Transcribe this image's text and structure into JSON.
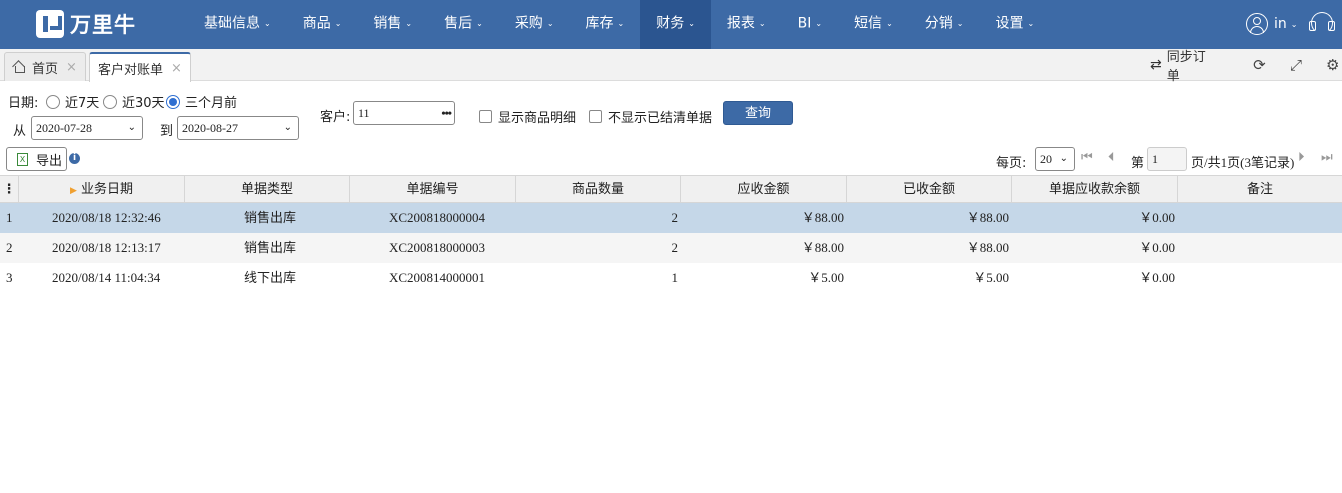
{
  "brand": {
    "name": "万里牛"
  },
  "nav": {
    "items": [
      {
        "label": "基础信息"
      },
      {
        "label": "商品"
      },
      {
        "label": "销售"
      },
      {
        "label": "售后"
      },
      {
        "label": "采购"
      },
      {
        "label": "库存"
      },
      {
        "label": "财务",
        "active": true
      },
      {
        "label": "报表"
      },
      {
        "label": "BI"
      },
      {
        "label": "短信"
      },
      {
        "label": "分销"
      },
      {
        "label": "设置"
      }
    ],
    "user": "in"
  },
  "tabs": [
    {
      "label": "首页",
      "close": "×",
      "icon": "home-icon"
    },
    {
      "label": "客户对账单",
      "close": "×",
      "active": true
    }
  ],
  "tools": {
    "sync_label": "同步订单",
    "sync_glyph": "⇄"
  },
  "filters": {
    "date_label": "日期:",
    "ranges": [
      "近7天",
      "近30天",
      "三个月前"
    ],
    "selected_range": "三个月前",
    "from_label": "从",
    "from_value": "2020-07-28",
    "to_label": "到",
    "to_value": "2020-08-27",
    "customer_label": "客户:",
    "customer_value": "11",
    "customer_button": "•••",
    "show_detail_label": "显示商品明细",
    "hide_settled_label": "不显示已结清单据",
    "query_label": "查询"
  },
  "toolbar": {
    "export_label": "导出",
    "export_icon_glyph": "X",
    "info_glyph": "i"
  },
  "pager": {
    "per_page_label": "每页:",
    "per_page": "20",
    "page_prefix": "第",
    "page": "1",
    "page_suffix": "页/共1页(3笔记录)"
  },
  "grid": {
    "columns": [
      "业务日期",
      "单据类型",
      "单据编号",
      "商品数量",
      "应收金额",
      "已收金额",
      "单据应收款余额",
      "备注"
    ],
    "rows": [
      {
        "no": "1",
        "date": "2020/08/18 12:32:46",
        "type": "销售出库",
        "code": "XC200818000004",
        "qty": "2",
        "receivable": "￥88.00",
        "received": "￥88.00",
        "balance": "￥0.00",
        "note": ""
      },
      {
        "no": "2",
        "date": "2020/08/18 12:13:17",
        "type": "销售出库",
        "code": "XC200818000003",
        "qty": "2",
        "receivable": "￥88.00",
        "received": "￥88.00",
        "balance": "￥0.00",
        "note": ""
      },
      {
        "no": "3",
        "date": "2020/08/14 11:04:34",
        "type": "线下出库",
        "code": "XC200814000001",
        "qty": "1",
        "receivable": "￥5.00",
        "received": "￥5.00",
        "balance": "￥0.00",
        "note": ""
      }
    ],
    "selected_row": 1
  }
}
